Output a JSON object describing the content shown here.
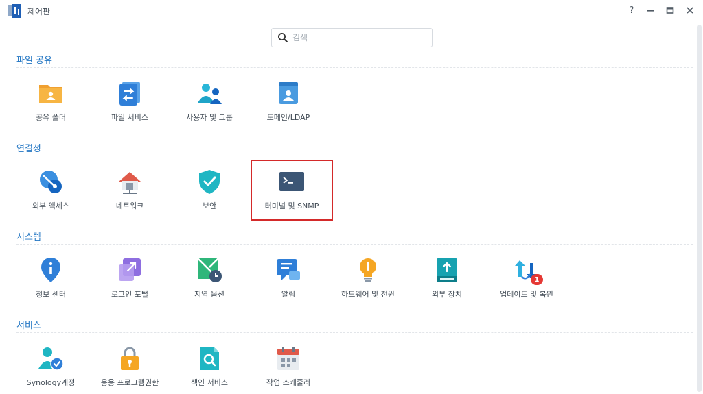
{
  "window": {
    "title": "제어판",
    "help_label": "?",
    "minimize_label": "–",
    "maximize_label": "□",
    "close_label": "✕"
  },
  "search": {
    "placeholder": "검색",
    "value": ""
  },
  "sections": [
    {
      "title": "파일 공유",
      "items": [
        {
          "label": "공유 폴더",
          "icon": "shared-folder-icon"
        },
        {
          "label": "파일 서비스",
          "icon": "file-services-icon"
        },
        {
          "label": "사용자 및 그룹",
          "icon": "user-group-icon"
        },
        {
          "label": "도메인/LDAP",
          "icon": "domain-ldap-icon"
        }
      ]
    },
    {
      "title": "연결성",
      "items": [
        {
          "label": "외부 액세스",
          "icon": "external-access-icon"
        },
        {
          "label": "네트워크",
          "icon": "network-icon"
        },
        {
          "label": "보안",
          "icon": "security-shield-icon"
        },
        {
          "label": "터미널 및 SNMP",
          "icon": "terminal-icon",
          "highlighted": true
        }
      ]
    },
    {
      "title": "시스템",
      "items": [
        {
          "label": "정보 센터",
          "icon": "info-center-icon"
        },
        {
          "label": "로그인 포털",
          "icon": "login-portal-icon"
        },
        {
          "label": "지역 옵션",
          "icon": "regional-options-icon"
        },
        {
          "label": "알림",
          "icon": "notification-icon"
        },
        {
          "label": "하드웨어 및 전원",
          "icon": "hardware-power-icon"
        },
        {
          "label": "외부 장치",
          "icon": "external-devices-icon"
        },
        {
          "label": "업데이트 및 복원",
          "icon": "update-restore-icon",
          "badge": "1"
        }
      ]
    },
    {
      "title": "서비스",
      "items": [
        {
          "label": "Synology계정",
          "icon": "synology-account-icon"
        },
        {
          "label": "응용 프로그램권한",
          "icon": "app-privileges-icon"
        },
        {
          "label": "색인 서비스",
          "icon": "indexing-service-icon"
        },
        {
          "label": "작업 스케줄러",
          "icon": "task-scheduler-icon"
        }
      ]
    }
  ],
  "colors": {
    "section_title": "#2477c4",
    "highlight_border": "#d42a2a",
    "badge": "#e53935"
  }
}
